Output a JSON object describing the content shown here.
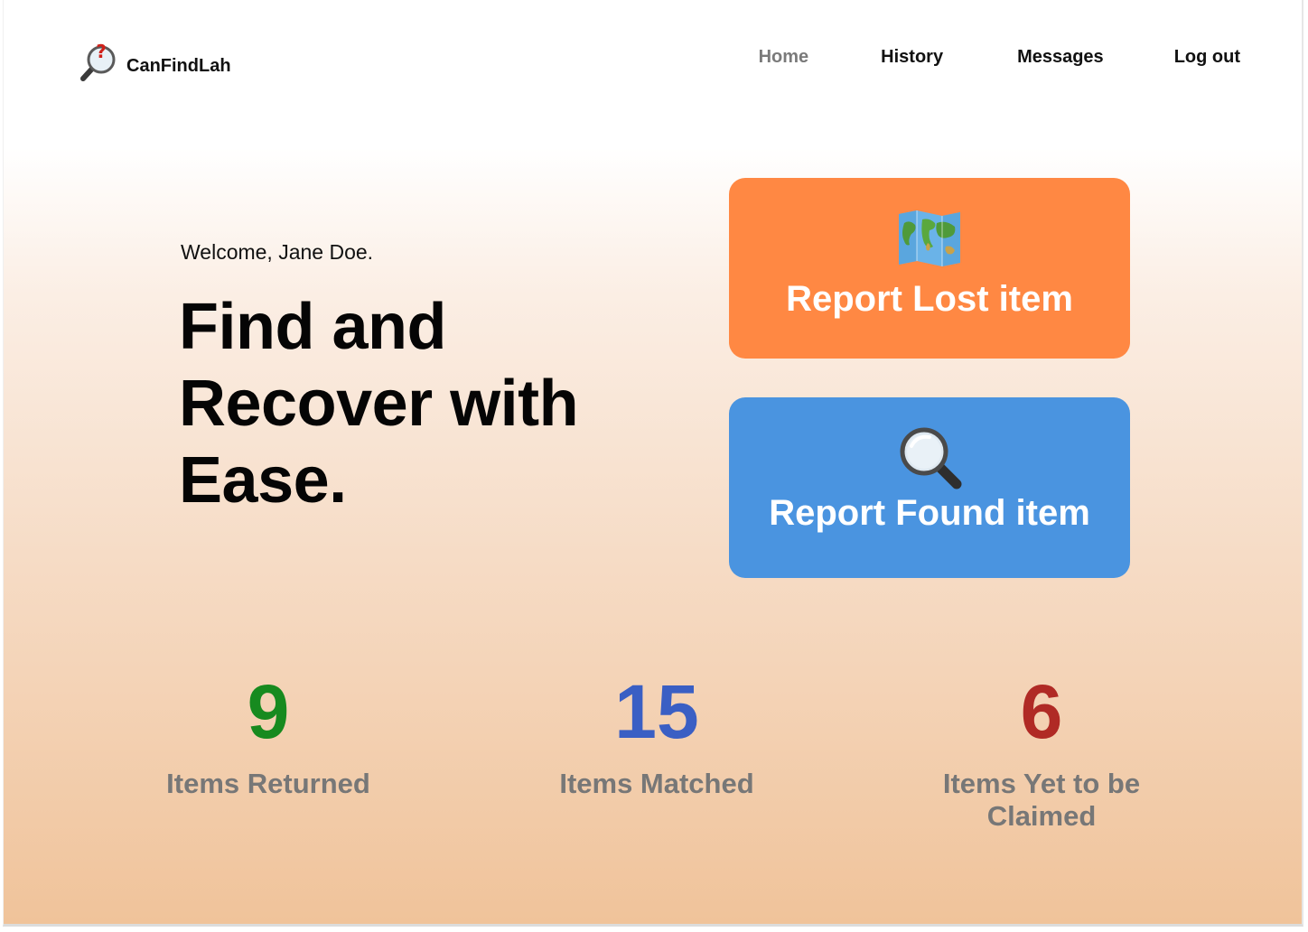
{
  "app": {
    "name": "CanFindLah",
    "logo_icon": "magnifier-question-icon"
  },
  "nav": {
    "items": [
      {
        "label": "Home",
        "active": true
      },
      {
        "label": "History",
        "active": false
      },
      {
        "label": "Messages",
        "active": false
      },
      {
        "label": "Log out",
        "active": false
      }
    ]
  },
  "hero": {
    "welcome": "Welcome, Jane Doe.",
    "headline_line1": "Find and",
    "headline_line2": "Recover with",
    "headline_line3": "Ease."
  },
  "actions": {
    "lost": {
      "label": "Report Lost item",
      "icon": "world-map-icon",
      "color": "#ff8843"
    },
    "found": {
      "label": "Report Found item",
      "icon": "magnifying-glass-icon",
      "color": "#4a94e0"
    }
  },
  "stats": [
    {
      "value": "9",
      "label": "Items Returned",
      "color": "#178a1f"
    },
    {
      "value": "15",
      "label": "Items Matched",
      "color": "#3a5fc4"
    },
    {
      "value": "6",
      "label": "Items Yet to be Claimed",
      "color": "#b02a25"
    }
  ],
  "colors": {
    "nav_active": "#7a7a7a",
    "stat_label": "#777777"
  }
}
